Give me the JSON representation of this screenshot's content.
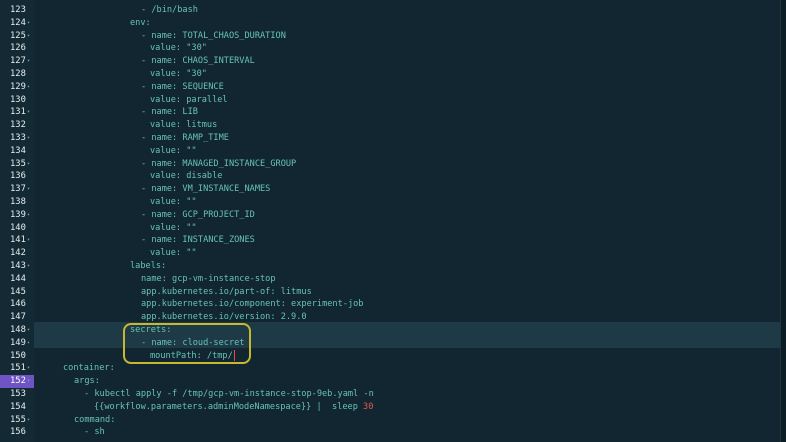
{
  "editor": {
    "language": "yaml",
    "active_line": 152,
    "lines": [
      {
        "n": "123",
        "text": "- /bin/bash"
      },
      {
        "n": "124",
        "text": "env:"
      },
      {
        "n": "125",
        "text": "- name: TOTAL_CHAOS_DURATION"
      },
      {
        "n": "126",
        "text": "value: \"30\""
      },
      {
        "n": "127",
        "text": "- name: CHAOS_INTERVAL"
      },
      {
        "n": "128",
        "text": "value: \"30\""
      },
      {
        "n": "129",
        "text": "- name: SEQUENCE"
      },
      {
        "n": "130",
        "text": "value: parallel"
      },
      {
        "n": "131",
        "text": "- name: LIB"
      },
      {
        "n": "132",
        "text": "value: litmus"
      },
      {
        "n": "133",
        "text": "- name: RAMP_TIME"
      },
      {
        "n": "134",
        "text": "value: \"\""
      },
      {
        "n": "135",
        "text": "- name: MANAGED_INSTANCE_GROUP"
      },
      {
        "n": "136",
        "text": "value: disable"
      },
      {
        "n": "137",
        "text": "- name: VM_INSTANCE_NAMES"
      },
      {
        "n": "138",
        "text": "value: \"\""
      },
      {
        "n": "139",
        "text": "- name: GCP_PROJECT_ID"
      },
      {
        "n": "140",
        "text": "value: \"\""
      },
      {
        "n": "141",
        "text": "- name: INSTANCE_ZONES"
      },
      {
        "n": "142",
        "text": "value: \"\""
      },
      {
        "n": "143",
        "text": "labels:"
      },
      {
        "n": "144",
        "text": "name: gcp-vm-instance-stop"
      },
      {
        "n": "145",
        "text": "app.kubernetes.io/part-of: litmus"
      },
      {
        "n": "146",
        "text": "app.kubernetes.io/component: experiment-job"
      },
      {
        "n": "147",
        "text": "app.kubernetes.io/version: 2.9.0"
      },
      {
        "n": "148",
        "text": "secrets:"
      },
      {
        "n": "149",
        "text": "- name: cloud-secret"
      },
      {
        "n": "150",
        "text": "mountPath: /tmp/"
      },
      {
        "n": "151",
        "text": "container:"
      },
      {
        "n": "152",
        "text": "args:"
      },
      {
        "n": "153",
        "text": "- kubectl apply -f /tmp/gcp-vm-instance-stop-9eb.yaml -n"
      },
      {
        "n": "154",
        "text": "{{workflow.parameters.adminModeNamespace}} |  sleep ",
        "num": "30"
      },
      {
        "n": "155",
        "text": "command:"
      },
      {
        "n": "156",
        "text": "- sh"
      }
    ]
  },
  "colors": {
    "background": "#112630",
    "code_text": "#68c2b7",
    "line_number": "#e6edf0",
    "active_line_number_bg": "#6f54c6",
    "annotation_box": "#c7b92f",
    "numeric_literal": "#e7584b",
    "caret": "#ff4040"
  }
}
